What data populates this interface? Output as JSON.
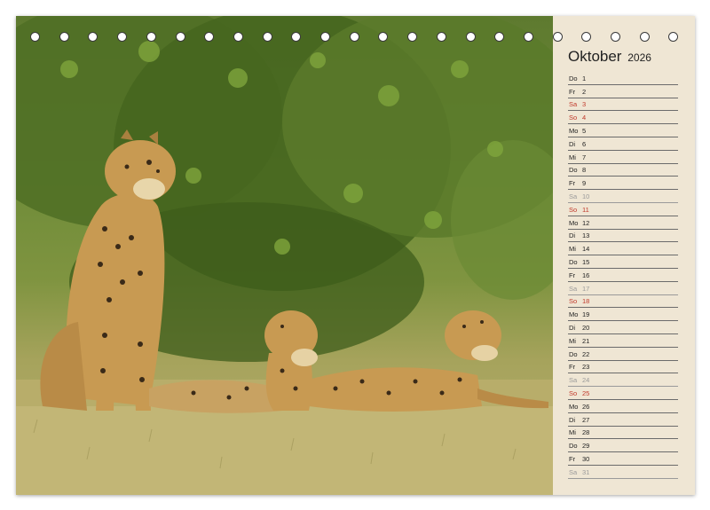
{
  "month": {
    "name": "Oktober",
    "year": "2026"
  },
  "days": [
    {
      "wd": "Do",
      "n": "1",
      "type": "weekday"
    },
    {
      "wd": "Fr",
      "n": "2",
      "type": "weekday"
    },
    {
      "wd": "Sa",
      "n": "3",
      "type": "sunday"
    },
    {
      "wd": "So",
      "n": "4",
      "type": "sunday"
    },
    {
      "wd": "Mo",
      "n": "5",
      "type": "weekday"
    },
    {
      "wd": "Di",
      "n": "6",
      "type": "weekday"
    },
    {
      "wd": "Mi",
      "n": "7",
      "type": "weekday"
    },
    {
      "wd": "Do",
      "n": "8",
      "type": "weekday"
    },
    {
      "wd": "Fr",
      "n": "9",
      "type": "weekday"
    },
    {
      "wd": "Sa",
      "n": "10",
      "type": "saturday"
    },
    {
      "wd": "So",
      "n": "11",
      "type": "sunday"
    },
    {
      "wd": "Mo",
      "n": "12",
      "type": "weekday"
    },
    {
      "wd": "Di",
      "n": "13",
      "type": "weekday"
    },
    {
      "wd": "Mi",
      "n": "14",
      "type": "weekday"
    },
    {
      "wd": "Do",
      "n": "15",
      "type": "weekday"
    },
    {
      "wd": "Fr",
      "n": "16",
      "type": "weekday"
    },
    {
      "wd": "Sa",
      "n": "17",
      "type": "saturday"
    },
    {
      "wd": "So",
      "n": "18",
      "type": "sunday"
    },
    {
      "wd": "Mo",
      "n": "19",
      "type": "weekday"
    },
    {
      "wd": "Di",
      "n": "20",
      "type": "weekday"
    },
    {
      "wd": "Mi",
      "n": "21",
      "type": "weekday"
    },
    {
      "wd": "Do",
      "n": "22",
      "type": "weekday"
    },
    {
      "wd": "Fr",
      "n": "23",
      "type": "weekday"
    },
    {
      "wd": "Sa",
      "n": "24",
      "type": "saturday"
    },
    {
      "wd": "So",
      "n": "25",
      "type": "sunday"
    },
    {
      "wd": "Mo",
      "n": "26",
      "type": "weekday"
    },
    {
      "wd": "Di",
      "n": "27",
      "type": "weekday"
    },
    {
      "wd": "Mi",
      "n": "28",
      "type": "weekday"
    },
    {
      "wd": "Do",
      "n": "29",
      "type": "weekday"
    },
    {
      "wd": "Fr",
      "n": "30",
      "type": "weekday"
    },
    {
      "wd": "Sa",
      "n": "31",
      "type": "saturday"
    }
  ],
  "binding_ring_count": 23,
  "photo": {
    "subject": "cheetah-family"
  },
  "colors": {
    "panel": "#efe6d4",
    "sunday": "#c0392b",
    "saturday": "#9a9a9a",
    "text": "#222222"
  }
}
